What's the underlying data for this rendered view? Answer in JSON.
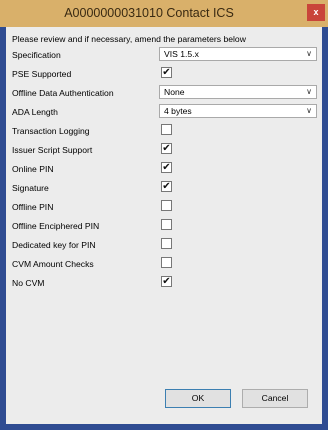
{
  "window": {
    "title": "A0000000031010 Contact ICS",
    "close_glyph": "x",
    "close_color": "#c9453a",
    "title_bar_color": "#d9b06a"
  },
  "instruction": "Please review and if necessary, amend the parameters below",
  "fields": {
    "specification": {
      "label": "Specification",
      "value": "VIS 1.5.x"
    },
    "pse_supported": {
      "label": "PSE Supported",
      "checked": true
    },
    "offline_data_auth": {
      "label": "Offline Data Authentication",
      "value": "None"
    },
    "ada_length": {
      "label": "ADA Length",
      "value": "4 bytes"
    },
    "transaction_logging": {
      "label": "Transaction Logging",
      "checked": false
    },
    "issuer_script_support": {
      "label": "Issuer Script Support",
      "checked": true
    },
    "online_pin": {
      "label": "Online PIN",
      "checked": true
    },
    "signature": {
      "label": "Signature",
      "checked": true
    },
    "offline_pin": {
      "label": "Offline PIN",
      "checked": false
    },
    "offline_enciphered_pin": {
      "label": "Offline Enciphered PIN",
      "checked": false
    },
    "dedicated_key_pin": {
      "label": "Dedicated key for PIN",
      "checked": false
    },
    "cvm_amount_checks": {
      "label": "CVM Amount Checks",
      "checked": false
    },
    "no_cvm": {
      "label": "No CVM",
      "checked": true
    }
  },
  "buttons": {
    "ok": "OK",
    "cancel": "Cancel"
  },
  "icons": {
    "checkmark": "✔",
    "dropdown": "chevron-down-icon"
  }
}
